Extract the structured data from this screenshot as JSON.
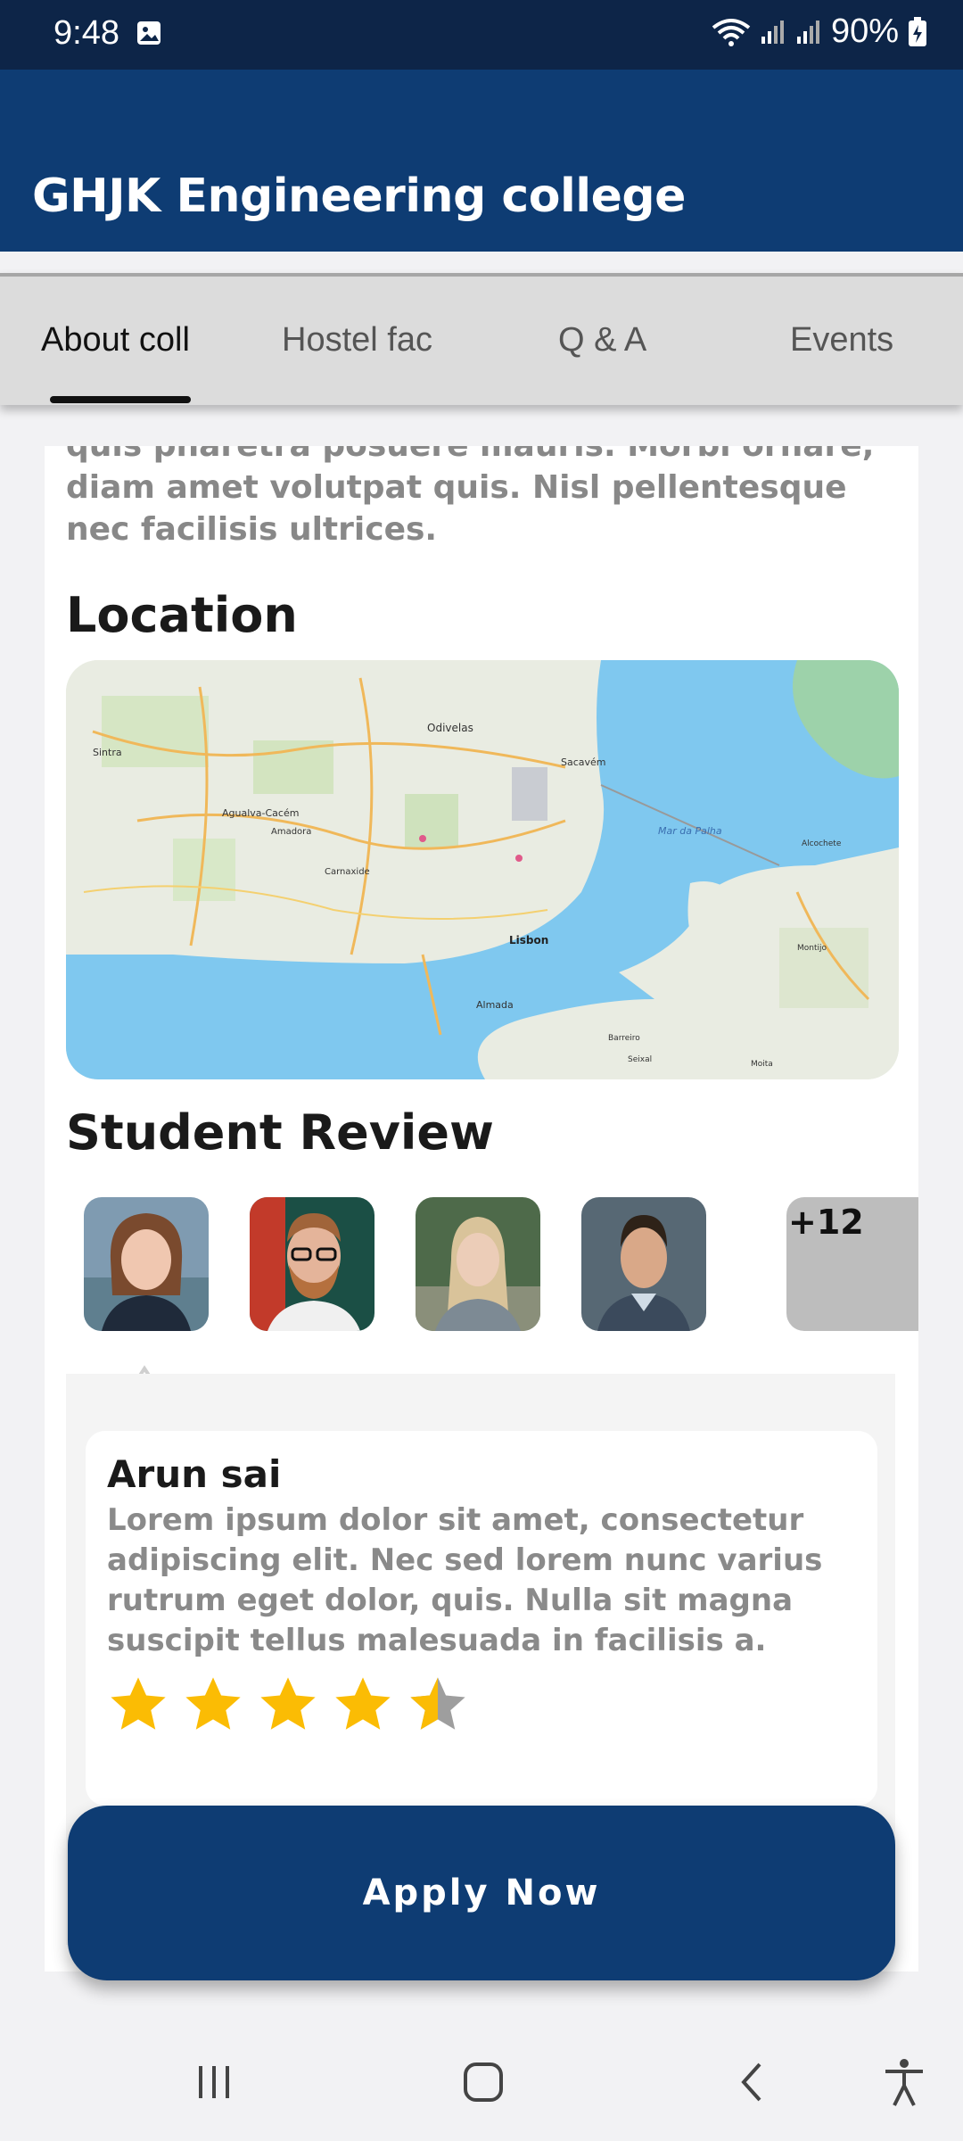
{
  "status_bar": {
    "time": "9:48",
    "battery": "90%",
    "icons": [
      "gallery-icon",
      "wifi-icon",
      "signal-icon",
      "signal-icon",
      "battery-charging-icon"
    ]
  },
  "header": {
    "title": "GHJK Engineering college"
  },
  "tabs": [
    {
      "label": "About coll",
      "active": true
    },
    {
      "label": "Hostel fac",
      "active": false
    },
    {
      "label": "Q & A",
      "active": false
    },
    {
      "label": "Events",
      "active": false
    }
  ],
  "about": {
    "intro_text": "quis pharetra posuere mauris. Morbi ornare, diam amet volutpat quis. Nisl pellentesque nec facilisis ultrices."
  },
  "location": {
    "heading": "Location",
    "map_labels": [
      "Odivelas",
      "Sacavém",
      "Agualva-Cacém",
      "Sintra",
      "Amadora",
      "Carnaxide",
      "Lisbon",
      "Almada",
      "Mar da Palha",
      "Alcochete",
      "Barreiro",
      "Moita",
      "Montijo",
      "Seixal"
    ]
  },
  "reviews": {
    "heading": "Student Review",
    "avatars": [
      "student-1",
      "student-2",
      "student-3",
      "student-4"
    ],
    "more_count": "+12",
    "selected": {
      "name": "Arun sai",
      "text": "Lorem ipsum dolor sit amet, consectetur adipiscing elit. Nec sed lorem nunc varius rutrum eget dolor, quis. Nulla sit magna suscipit tellus malesuada in facilisis a.",
      "rating": 4.5,
      "rating_max": 5
    }
  },
  "apply_button": {
    "label": "Apply Now"
  },
  "colors": {
    "primary": "#0e3c73",
    "status_bar": "#0d2548",
    "star": "#fbbc04",
    "star_empty": "#9e9e9e"
  },
  "nav_bar": {
    "icons": [
      "recent-apps-icon",
      "home-icon",
      "back-icon",
      "accessibility-icon"
    ]
  }
}
